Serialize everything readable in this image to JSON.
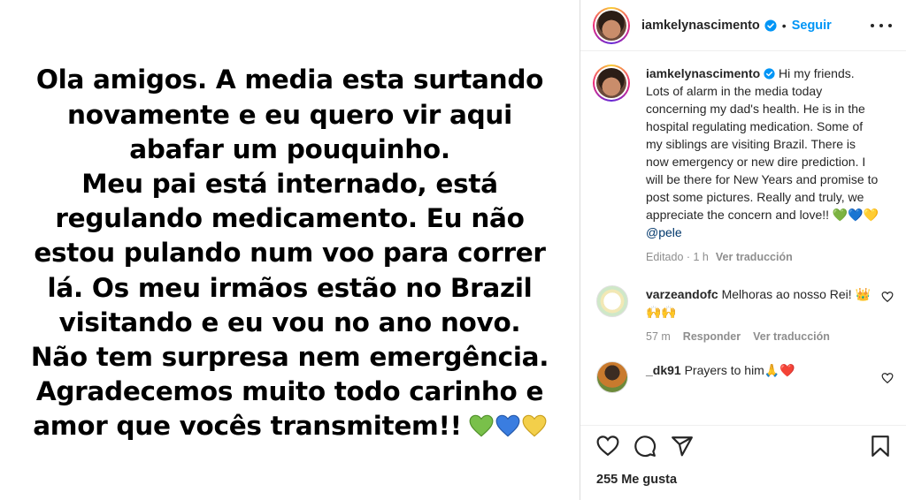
{
  "post": {
    "image_text_lines": [
      "Ola amigos. A media esta surtando",
      "novamente e eu quero vir aqui",
      "abafar um pouquinho.",
      "Meu pai está internado, está",
      "regulando medicamento. Eu não",
      "estou pulando num voo para correr",
      "lá. Os meu irmãos estão no Brazil",
      "visitando e eu vou no ano novo.",
      "Não tem surpresa nem emergência.",
      "Agradecemos muito todo carinho e",
      "amor que vocês transmitem!!"
    ],
    "image_hearts": [
      "green-heart",
      "blue-heart",
      "yellow-heart"
    ]
  },
  "header": {
    "username": "iamkelynascimento",
    "separator": "•",
    "follow_label": "Seguir"
  },
  "caption": {
    "username": "iamkelynascimento",
    "text": " Hi my friends. Lots of alarm in the media today concerning my dad's health. He is in the hospital regulating medication. Some of my siblings are visiting Brazil. There is now emergency or new dire prediction. I will be there for New Years and promise to post some pictures. Really and truly, we appreciate the concern and love!! 💚💙💛 ",
    "mention": "@pele",
    "edited": "Editado · 1 h",
    "translate": "Ver traducción"
  },
  "comments": [
    {
      "username": "varzeandofc",
      "text": " Melhoras ao nosso Rei! 👑 🙌🙌",
      "time": "57 m",
      "reply": "Responder",
      "translate": "Ver traducción"
    },
    {
      "username": "_dk91",
      "text": " Prayers to him🙏❤️"
    }
  ],
  "footer": {
    "likes": "255 Me gusta"
  },
  "colors": {
    "accent": "#0095f6",
    "text": "#262626",
    "muted": "#8e8e8e"
  }
}
